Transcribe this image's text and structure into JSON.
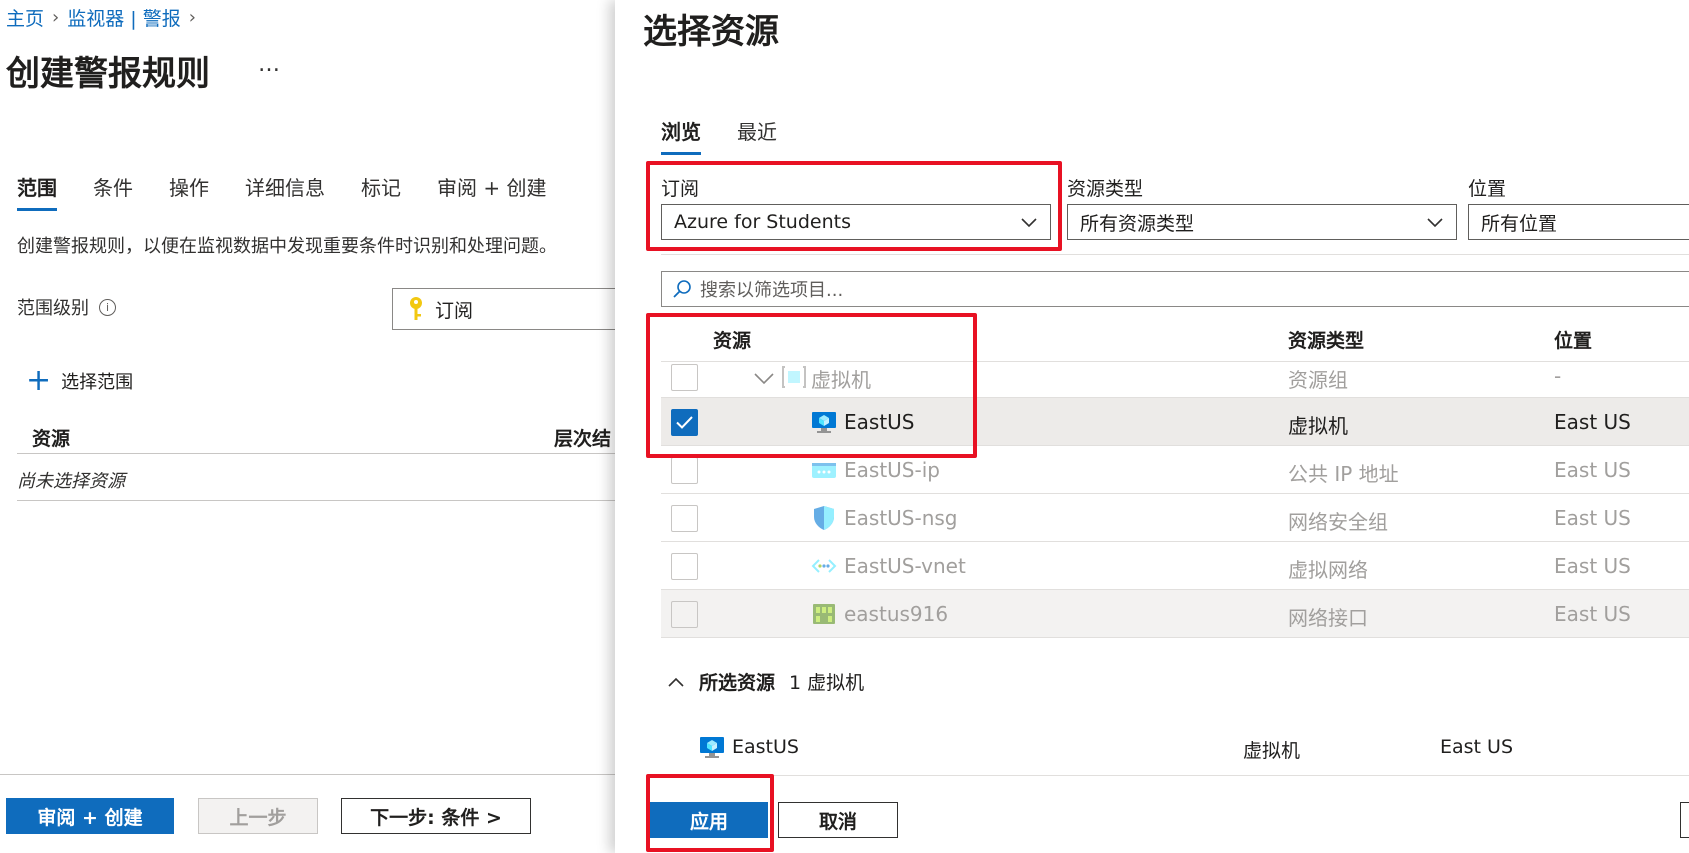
{
  "breadcrumb": {
    "home": "主页",
    "monitor": "监视器 | 警报"
  },
  "page": {
    "title": "创建警报规则",
    "more": "…"
  },
  "steps": [
    "范围",
    "条件",
    "操作",
    "详细信息",
    "标记",
    "审阅 + 创建"
  ],
  "description": "创建警报规则，以便在监视数据中发现重要条件时识别和处理问题。",
  "scope": {
    "level_label": "范围级别",
    "info": "i",
    "level_value": "订阅"
  },
  "select_scope": {
    "label": "选择范围"
  },
  "left_table": {
    "col_resource": "资源",
    "col_hierarchy": "层次结",
    "empty": "尚未选择资源"
  },
  "footer": {
    "review_create": "审阅 + 创建",
    "previous": "上一步",
    "next": "下一步: 条件 >"
  },
  "panel": {
    "title": "选择资源",
    "tabs": [
      "浏览",
      "最近"
    ],
    "filters": {
      "subscription_label": "订阅",
      "subscription_value": "Azure for Students",
      "resource_type_label": "资源类型",
      "resource_type_value": "所有资源类型",
      "location_label": "位置",
      "location_value": "所有位置"
    },
    "search_placeholder": "搜索以筛选项目...",
    "table": {
      "headers": {
        "resource": "资源",
        "type": "资源类型",
        "location": "位置"
      },
      "rows": [
        {
          "name": "虚拟机",
          "type": "资源组",
          "location": "-",
          "icon": "resource-group-icon",
          "checked": false
        },
        {
          "name": "EastUS",
          "type": "虚拟机",
          "location": "East US",
          "icon": "virtual-machine-icon",
          "checked": true
        },
        {
          "name": "EastUS-ip",
          "type": "公共 IP 地址",
          "location": "East US",
          "icon": "public-ip-icon",
          "checked": false
        },
        {
          "name": "EastUS-nsg",
          "type": "网络安全组",
          "location": "East US",
          "icon": "network-security-group-icon",
          "checked": false
        },
        {
          "name": "EastUS-vnet",
          "type": "虚拟网络",
          "location": "East US",
          "icon": "virtual-network-icon",
          "checked": false
        },
        {
          "name": "eastus916",
          "type": "网络接口",
          "location": "East US",
          "icon": "network-interface-icon",
          "checked": false
        }
      ]
    },
    "selected": {
      "label": "所选资源",
      "summary": "1 虚拟机",
      "item": {
        "name": "EastUS",
        "type": "虚拟机",
        "location": "East US"
      }
    },
    "buttons": {
      "apply": "应用",
      "cancel": "取消"
    }
  },
  "colors": {
    "accent": "#0f6cbd",
    "highlight": "#e81123"
  }
}
